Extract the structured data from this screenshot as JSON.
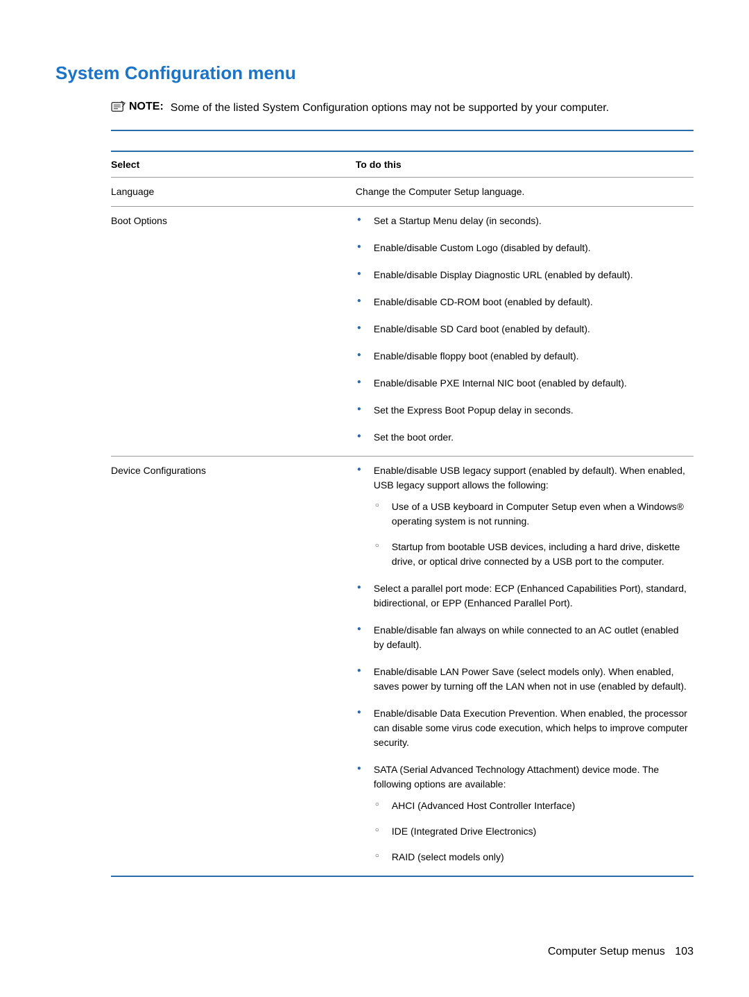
{
  "heading": "System Configuration menu",
  "note": {
    "label": "NOTE:",
    "text": "Some of the listed System Configuration options may not be supported by your computer."
  },
  "table": {
    "headers": {
      "select": "Select",
      "todo": "To do this"
    },
    "rows": [
      {
        "select": "Language",
        "plain": "Change the Computer Setup language."
      },
      {
        "select": "Boot Options",
        "bullets": [
          {
            "text": "Set a Startup Menu delay (in seconds)."
          },
          {
            "text": "Enable/disable Custom Logo (disabled by default)."
          },
          {
            "text": "Enable/disable Display Diagnostic URL (enabled by default)."
          },
          {
            "text": "Enable/disable CD-ROM boot (enabled by default)."
          },
          {
            "text": "Enable/disable SD Card boot (enabled by default)."
          },
          {
            "text": "Enable/disable floppy boot (enabled by default)."
          },
          {
            "text": "Enable/disable PXE Internal NIC boot (enabled by default)."
          },
          {
            "text": "Set the Express Boot Popup delay in seconds."
          },
          {
            "text": "Set the boot order."
          }
        ]
      },
      {
        "select": "Device Configurations",
        "bullets": [
          {
            "text": "Enable/disable USB legacy support (enabled by default). When enabled, USB legacy support allows the following:",
            "sub": [
              "Use of a USB keyboard in Computer Setup even when a Windows® operating system is not running.",
              "Startup from bootable USB devices, including a hard drive, diskette drive, or optical drive connected by a USB port to the computer."
            ]
          },
          {
            "text": "Select a parallel port mode: ECP (Enhanced Capabilities Port), standard, bidirectional, or EPP (Enhanced Parallel Port)."
          },
          {
            "text": "Enable/disable fan always on while connected to an AC outlet (enabled by default)."
          },
          {
            "text": "Enable/disable LAN Power Save (select models only). When enabled, saves power by turning off the LAN when not in use (enabled by default)."
          },
          {
            "text": "Enable/disable Data Execution Prevention. When enabled, the processor can disable some virus code execution, which helps to improve computer security."
          },
          {
            "text": "SATA (Serial Advanced Technology Attachment) device mode. The following options are available:",
            "sub": [
              "AHCI (Advanced Host Controller Interface)",
              "IDE (Integrated Drive Electronics)",
              "RAID (select models only)"
            ]
          }
        ]
      }
    ]
  },
  "footer": {
    "section": "Computer Setup menus",
    "page": "103"
  }
}
